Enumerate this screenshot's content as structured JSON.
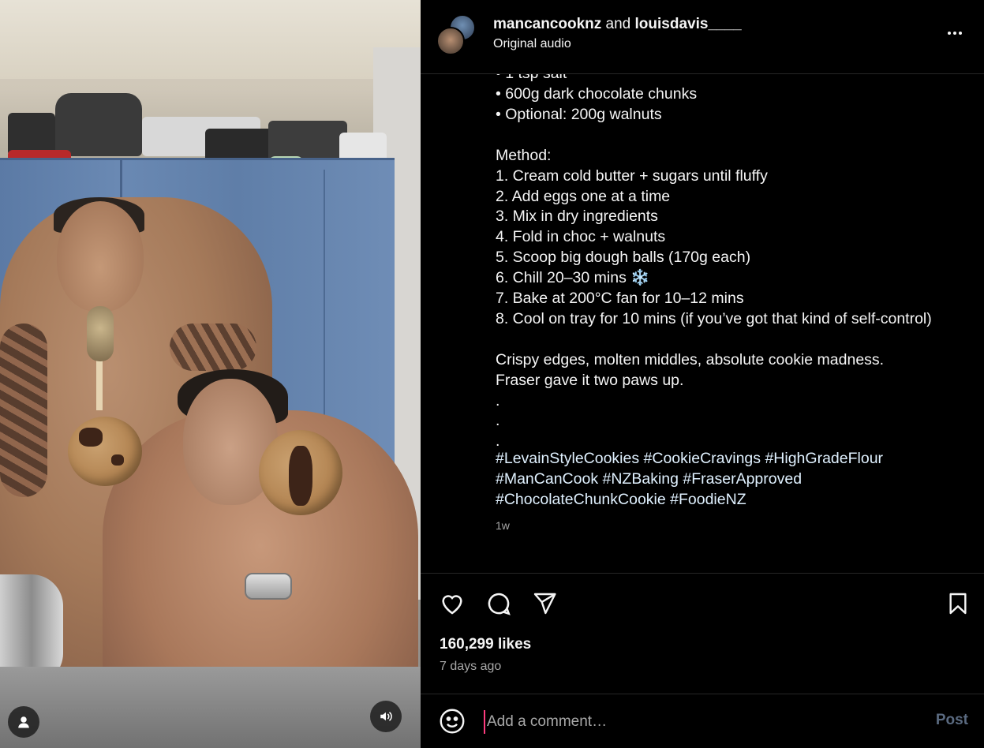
{
  "header": {
    "user1": "mancancooknz",
    "joiner": "and",
    "user2": "louisdavis____",
    "audio": "Original audio"
  },
  "caption": {
    "clipped_top": "• 1 tsp salt",
    "lines": [
      "• 600g dark chocolate chunks",
      "• Optional: 200g walnuts",
      "",
      "Method:",
      "1. Cream cold butter + sugars until fluffy",
      "2. Add eggs one at a time",
      "3. Mix in dry ingredients",
      "4. Fold in choc + walnuts",
      "5. Scoop big dough balls (170g each)",
      "6. Chill 20–30 mins ❄️",
      "7. Bake at 200°C fan for 10–12 mins",
      "8. Cool on tray for 10 mins (if you’ve got that kind of self-control)",
      "",
      "Crispy edges, molten middles, absolute cookie madness.",
      "Fraser gave it two paws up.",
      ".",
      ".",
      "."
    ],
    "hashtags": [
      "#LevainStyleCookies",
      "#CookieCravings",
      "#HighGradeFlour",
      "#ManCanCook",
      "#NZBaking",
      "#FraserApproved",
      "#ChocolateChunkCookie",
      "#FoodieNZ"
    ],
    "time_ago": "1w"
  },
  "actions": {
    "likes": "160,299 likes",
    "date": "7 days ago"
  },
  "comment": {
    "placeholder": "Add a comment…",
    "post_label": "Post"
  },
  "icons": {
    "like": "heart-icon",
    "comment": "comment-icon",
    "share": "send-icon",
    "save": "bookmark-icon",
    "emoji": "emoji-icon",
    "more": "more-icon",
    "tagged": "user-icon",
    "audio": "speaker-icon"
  }
}
